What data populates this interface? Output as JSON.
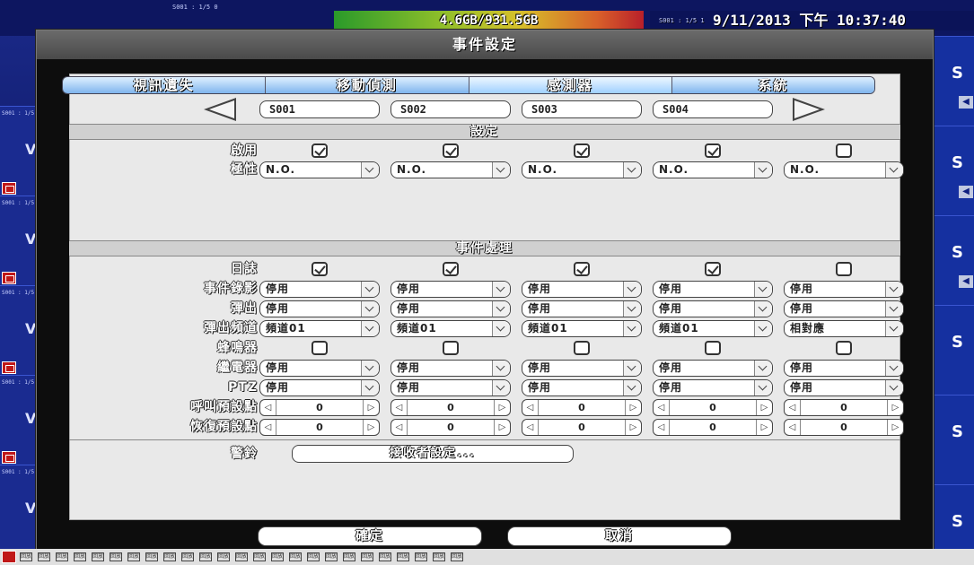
{
  "topbar": {
    "cam_label_1": "S001 : 1/5 0",
    "hdd_usage": "4.6GB/931.5GB",
    "datetime_prefix": "S001 : 1/5 1",
    "datetime": "9/11/2013 下午 10:37:40"
  },
  "side": {
    "right_letter": "S",
    "left_letter": "V",
    "left_label": "S001 : 1/5"
  },
  "dialog": {
    "title": "事件設定",
    "tabs": [
      "視訊遺失",
      "移動偵測",
      "感測器",
      "系統"
    ],
    "active_tab": 2,
    "sensors": [
      "S001",
      "S002",
      "S003",
      "S004"
    ],
    "section_settings": "設定",
    "section_event": "事件處理",
    "enable_label": "啟用",
    "polarity_label": "極性",
    "polarity_values": [
      "N.O.",
      "N.O.",
      "N.O.",
      "N.O.",
      "N.O."
    ],
    "enable_checked": [
      true,
      true,
      true,
      true,
      false
    ],
    "log_label": "日誌",
    "log_checked": [
      true,
      true,
      true,
      true,
      false
    ],
    "event_record_label": "事件錄影",
    "event_record_values": [
      "停用",
      "停用",
      "停用",
      "停用",
      "停用"
    ],
    "popup_label": "彈出",
    "popup_values": [
      "停用",
      "停用",
      "停用",
      "停用",
      "停用"
    ],
    "popup_channel_label": "彈出頻道",
    "popup_channel_values": [
      "頻道01",
      "頻道01",
      "頻道01",
      "頻道01",
      "相對應"
    ],
    "buzzer_label": "蜂鳴器",
    "buzzer_checked": [
      false,
      false,
      false,
      false,
      false
    ],
    "relay_label": "繼電器",
    "relay_values": [
      "停用",
      "停用",
      "停用",
      "停用",
      "停用"
    ],
    "ptz_label": "PTZ",
    "ptz_values": [
      "停用",
      "停用",
      "停用",
      "停用",
      "停用"
    ],
    "preset_call_label": "呼叫預設點",
    "preset_call_values": [
      "0",
      "0",
      "0",
      "0",
      "0"
    ],
    "preset_restore_label": "恢復預設點",
    "preset_restore_values": [
      "0",
      "0",
      "0",
      "0",
      "0"
    ],
    "bell_label": "警鈴",
    "receiver_button": "接收者設定...",
    "ok_button": "確定",
    "cancel_button": "取消"
  },
  "bottom_icon_text": "回放"
}
